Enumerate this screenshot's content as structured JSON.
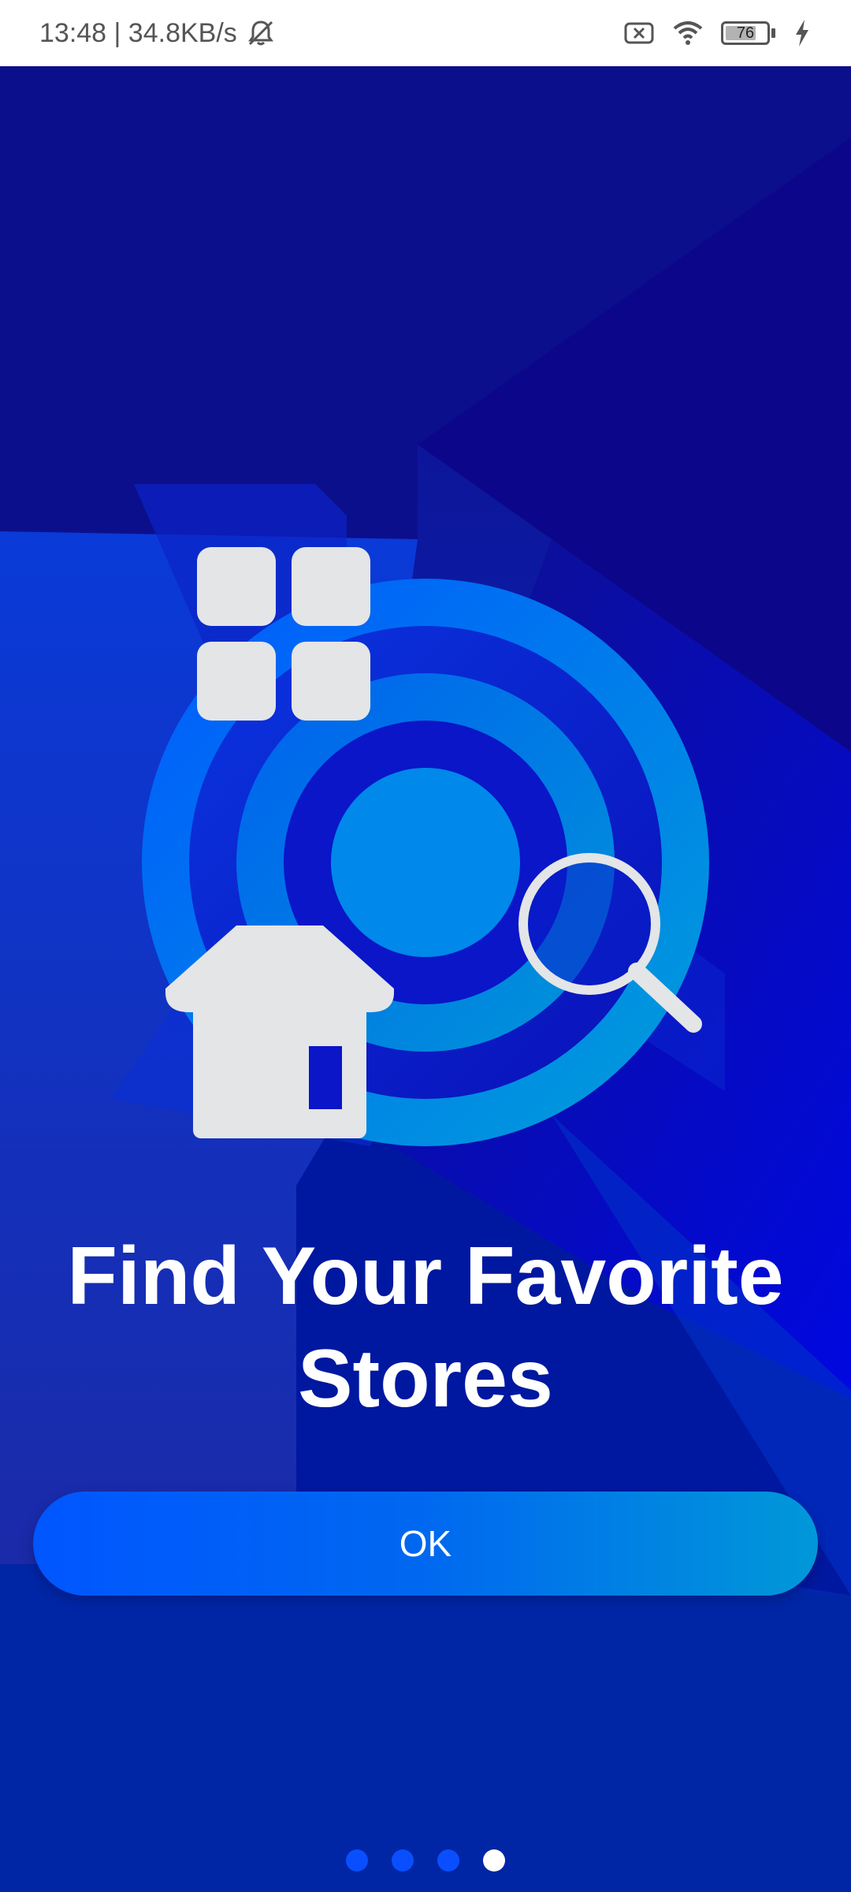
{
  "status_bar": {
    "time_speed": "13:48 | 34.8KB/s",
    "battery_level": "76",
    "battery_fraction": 0.76,
    "icons": [
      "mute-bell-icon",
      "sim-error-icon",
      "wifi-icon",
      "battery-icon",
      "charging-icon"
    ]
  },
  "onboarding": {
    "headline": "Find Your Favorite Stores",
    "ok_label": "OK",
    "page_count": 4,
    "active_page": 4
  },
  "colors": {
    "background_top": "#0f0f88",
    "background_bottom": "#0026a8",
    "button_start": "#0056ff",
    "button_end": "#0098d8",
    "icon_fill": "#e3e5e7",
    "dot_inactive": "#0a4fff",
    "dot_active": "#ffffff"
  },
  "illustration": {
    "icons": [
      "grid-icon",
      "target-icon",
      "house-icon",
      "magnifier-icon"
    ]
  }
}
